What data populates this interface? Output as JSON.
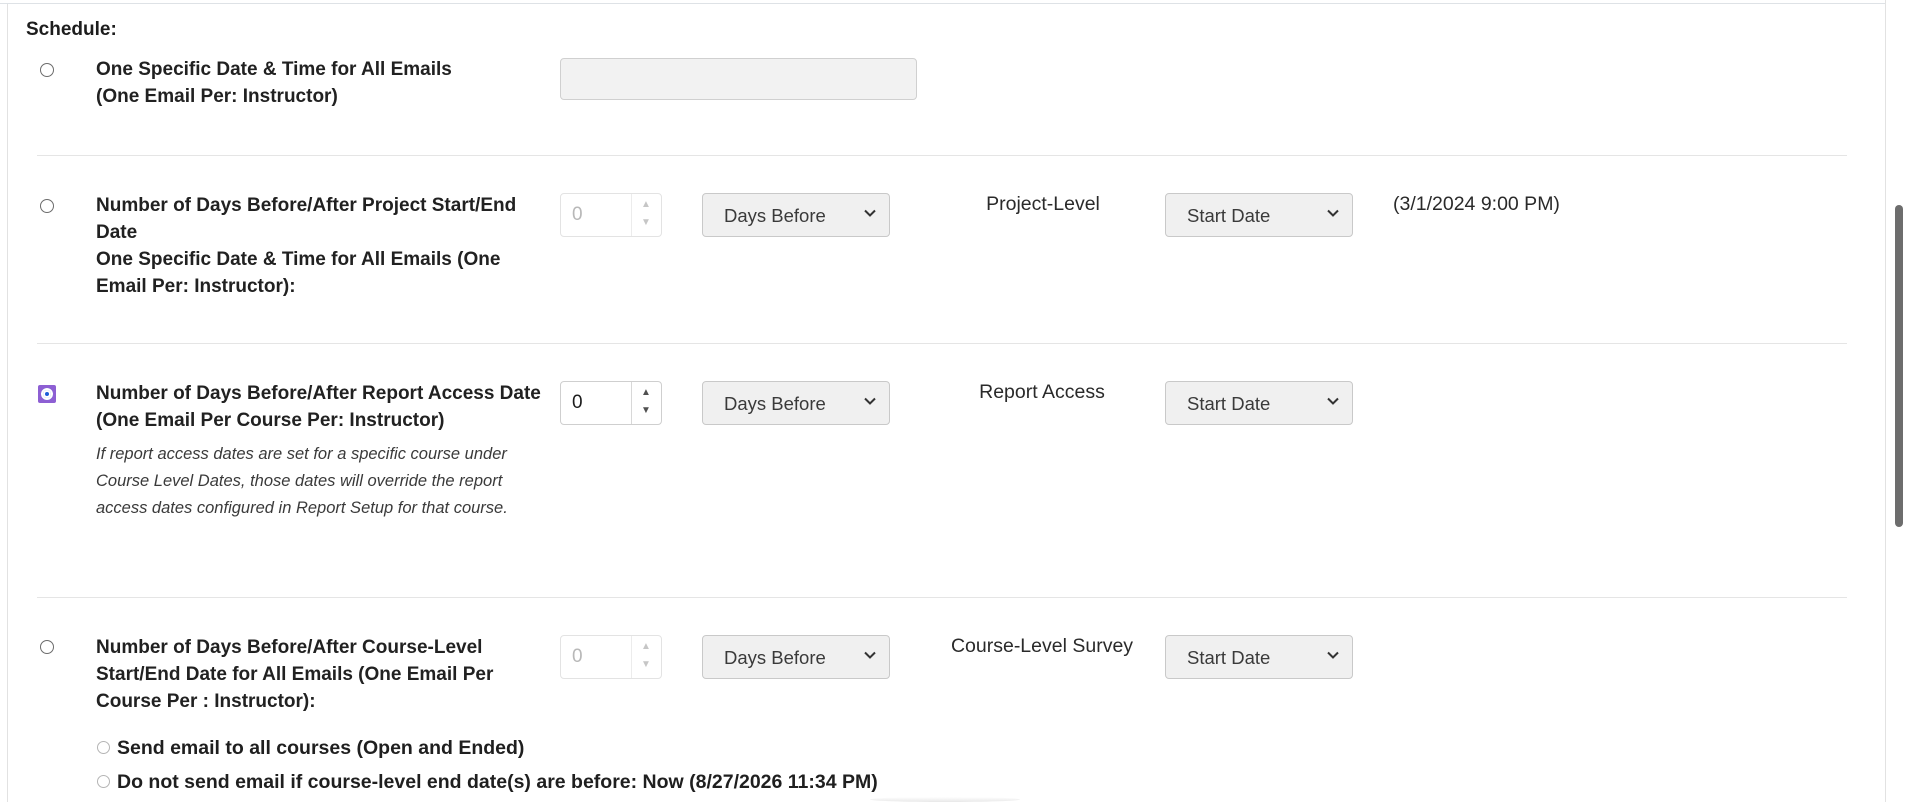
{
  "schedule": {
    "title": "Schedule:"
  },
  "options": [
    {
      "lines": [
        "One Specific Date & Time for All Emails",
        "(One Email Per: Instructor)"
      ],
      "selected": false,
      "datetime_input": ""
    },
    {
      "lines": [
        "Number of Days Before/After Project Start/End",
        "Date",
        "One Specific Date & Time for All Emails (One",
        "Email Per: Instructor):"
      ],
      "selected": false,
      "days_value": "0",
      "direction": "Days Before",
      "level_label": "Project-Level",
      "date_type": "Start Date",
      "computed_date": "(3/1/2024 9:00 PM)"
    },
    {
      "lines": [
        "Number of Days Before/After Report Access Date",
        "(One Email Per Course Per: Instructor)"
      ],
      "note_lines": [
        "If report access dates are set for a specific course under",
        "Course Level Dates, those dates will override the report",
        "access dates configured in Report Setup for that course."
      ],
      "selected": true,
      "days_value": "0",
      "direction": "Days Before",
      "level_label": "Report Access",
      "date_type": "Start Date"
    },
    {
      "lines": [
        "Number of Days Before/After Course-Level",
        "Start/End Date for All Emails (One Email Per",
        "Course Per : Instructor):"
      ],
      "selected": false,
      "days_value": "0",
      "direction": "Days Before",
      "level_label": "Course-Level Survey",
      "date_type": "Start Date",
      "sub_options": [
        {
          "label": "Send email to all courses (Open and Ended)",
          "selected": false
        },
        {
          "label": "Do not send email if course-level end date(s) are before: Now (8/27/2026 11:34 PM)",
          "selected": false
        }
      ]
    }
  ],
  "icons": {
    "dropdown": "chevron-down-icon",
    "spin_up": "caret-up-icon",
    "spin_down": "caret-down-icon"
  },
  "colors": {
    "selected_radio": "#1a5fd8",
    "focus_outline": "#8d5fd3",
    "disabled_input_bg": "#f2f2f2"
  }
}
